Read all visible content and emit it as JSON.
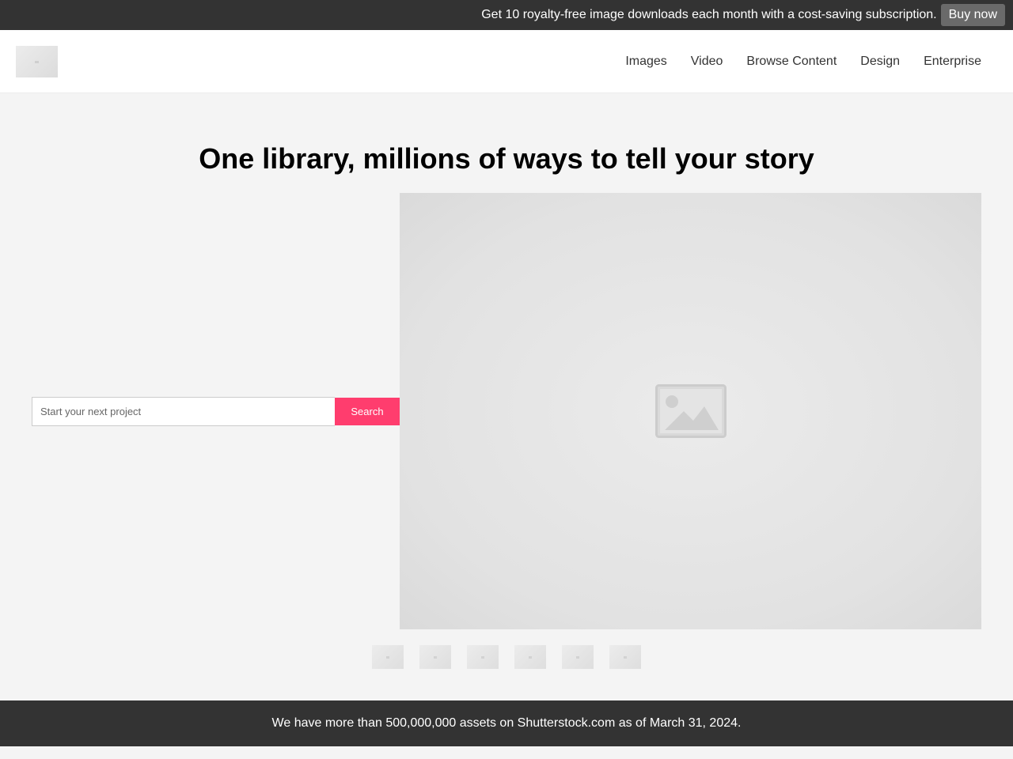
{
  "promo": {
    "text": "Get 10 royalty-free image downloads each month with a cost-saving subscription.",
    "button_label": "Buy now"
  },
  "header": {
    "logo_icon": "image-placeholder-icon",
    "nav": [
      {
        "label": "Images"
      },
      {
        "label": "Video"
      },
      {
        "label": "Browse Content"
      },
      {
        "label": "Design"
      },
      {
        "label": "Enterprise"
      }
    ]
  },
  "hero": {
    "title": "One library, millions of ways to tell your story",
    "search": {
      "value": "",
      "placeholder": "Start your next project",
      "button_label": "Search"
    },
    "image_icon": "image-placeholder-icon",
    "thumbnail_count": 6
  },
  "footer": {
    "text": "We have more than 500,000,000 assets on Shutterstock.com as of March 31, 2024."
  },
  "colors": {
    "dark_bar": "#333333",
    "search_button": "#ff3d6e",
    "page_background": "#f4f4f4"
  }
}
